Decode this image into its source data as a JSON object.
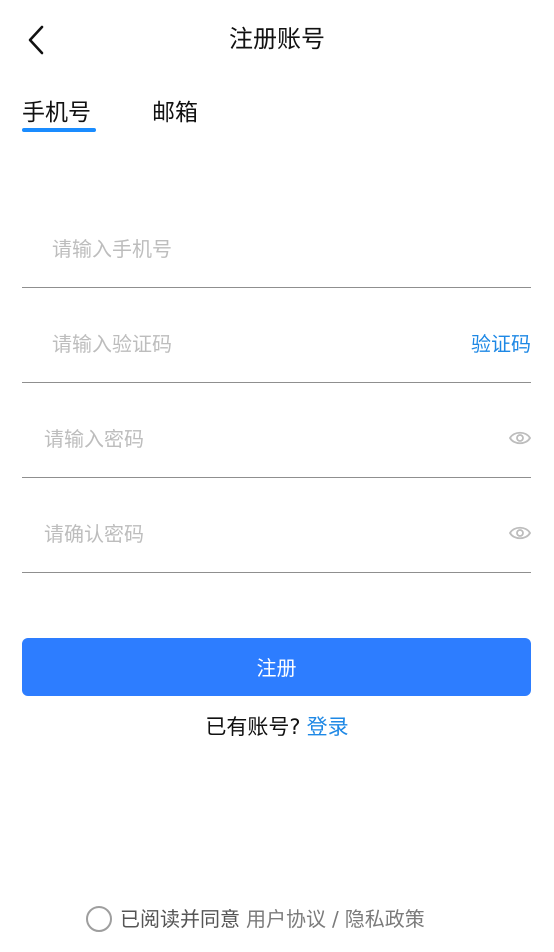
{
  "header": {
    "title": "注册账号",
    "back_icon": "chevron-left-icon"
  },
  "tabs": [
    {
      "label": "手机号",
      "active": true
    },
    {
      "label": "邮箱",
      "active": false
    }
  ],
  "form": {
    "phone_placeholder": "请输入手机号",
    "code_placeholder": "请输入验证码",
    "code_button": "验证码",
    "password_placeholder": "请输入密码",
    "confirm_placeholder": "请确认密码",
    "eye_icon": "eye-icon"
  },
  "submit_label": "注册",
  "login": {
    "question": "已有账号?",
    "link": "登录"
  },
  "agreement": {
    "text": "已阅读并同意",
    "user_agreement": "用户协议",
    "separator": "/",
    "privacy_policy": "隐私政策",
    "checked": false
  },
  "colors": {
    "accent": "#1a8cff",
    "button": "#2d7dff",
    "link": "#1e88e5",
    "placeholder": "#bdbdbd",
    "divider": "#8f8f8f"
  }
}
